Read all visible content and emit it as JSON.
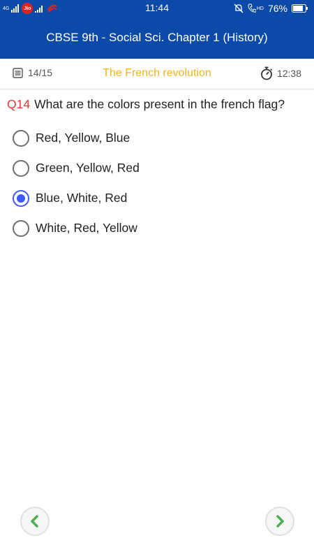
{
  "status_bar": {
    "time": "11:44",
    "battery": "76%",
    "network_left": "4G",
    "carrier": "Jio",
    "hd_label": "HD"
  },
  "app_bar": {
    "title": "CBSE 9th - Social Sci. Chapter 1 (History)"
  },
  "quiz_info": {
    "progress": "14/15",
    "chapter_title": "The French revolution",
    "time_left": "12:38"
  },
  "question": {
    "number": "Q14",
    "text": "What are the colors present in the french flag?"
  },
  "options": [
    {
      "label": "Red, Yellow, Blue",
      "selected": false
    },
    {
      "label": "Green, Yellow, Red",
      "selected": false
    },
    {
      "label": "Blue, White, Red",
      "selected": true
    },
    {
      "label": "White, Red, Yellow",
      "selected": false
    }
  ],
  "navigation": {
    "prev_icon": "chevron-left-icon",
    "next_icon": "chevron-right-icon"
  },
  "colors": {
    "app_bar": "#0b4aa8",
    "chapter_title": "#f0b323",
    "question_number": "#e53935",
    "radio_selected": "#3d5afe",
    "nav_arrow": "#4caf50"
  }
}
